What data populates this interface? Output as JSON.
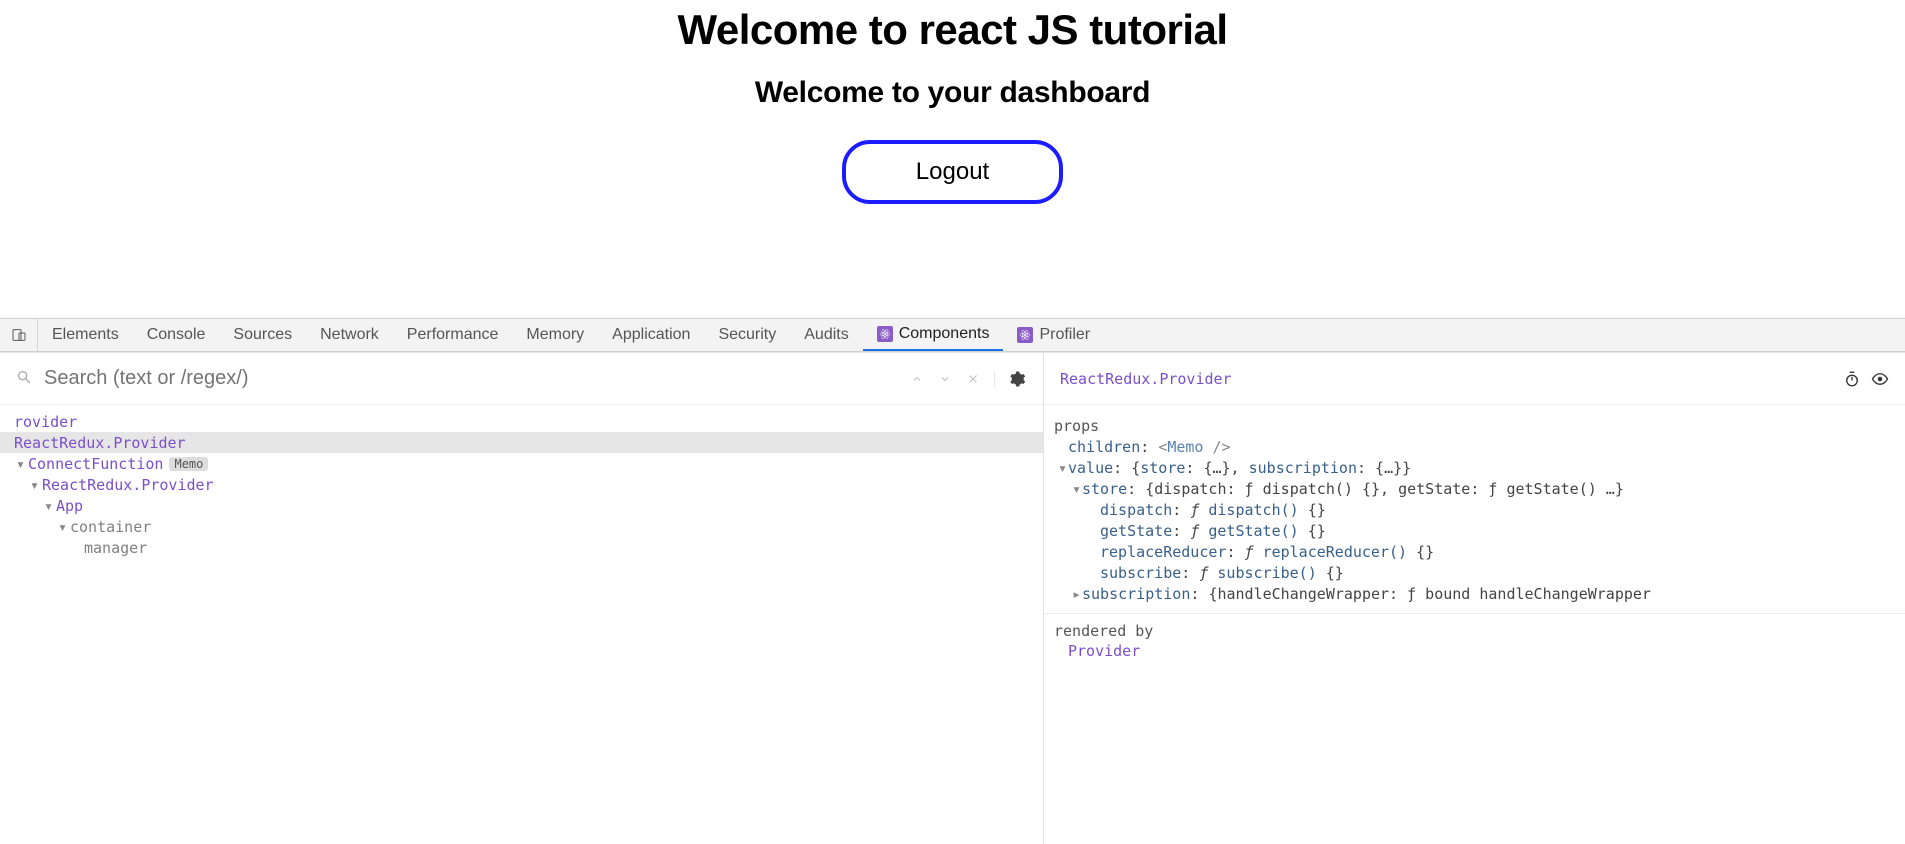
{
  "page": {
    "heading": "Welcome to react JS tutorial",
    "subheading": "Welcome to your dashboard",
    "logout_label": "Logout"
  },
  "devtools_tabs": [
    {
      "label": "Elements",
      "active": false,
      "react": false
    },
    {
      "label": "Console",
      "active": false,
      "react": false
    },
    {
      "label": "Sources",
      "active": false,
      "react": false
    },
    {
      "label": "Network",
      "active": false,
      "react": false
    },
    {
      "label": "Performance",
      "active": false,
      "react": false
    },
    {
      "label": "Memory",
      "active": false,
      "react": false
    },
    {
      "label": "Application",
      "active": false,
      "react": false
    },
    {
      "label": "Security",
      "active": false,
      "react": false
    },
    {
      "label": "Audits",
      "active": false,
      "react": false
    },
    {
      "label": "Components",
      "active": true,
      "react": true
    },
    {
      "label": "Profiler",
      "active": false,
      "react": true
    }
  ],
  "tree": {
    "search_placeholder": "Search (text or /regex/)",
    "nodes": [
      {
        "indent": 0,
        "caret": "",
        "label": "rovider",
        "selected": false,
        "badge": null,
        "dom": false
      },
      {
        "indent": 0,
        "caret": "",
        "label": "ReactRedux.Provider",
        "selected": true,
        "badge": null,
        "dom": false
      },
      {
        "indent": 1,
        "caret": "▾",
        "label": "ConnectFunction",
        "selected": false,
        "badge": "Memo",
        "dom": false
      },
      {
        "indent": 2,
        "caret": "▾",
        "label": "ReactRedux.Provider",
        "selected": false,
        "badge": null,
        "dom": false
      },
      {
        "indent": 3,
        "caret": "▾",
        "label": "App",
        "selected": false,
        "badge": null,
        "dom": false
      },
      {
        "indent": 4,
        "caret": "▾",
        "label": "container",
        "selected": false,
        "badge": null,
        "dom": true
      },
      {
        "indent": 5,
        "caret": "",
        "label": "manager",
        "selected": false,
        "badge": null,
        "dom": true
      }
    ]
  },
  "details": {
    "title": "ReactRedux.Provider",
    "props_label": "props",
    "children_key": "children",
    "children_val_tag": "Memo",
    "value_key": "value",
    "value_summary_keys": [
      "store",
      "subscription"
    ],
    "store_key": "store",
    "store_summary": "{dispatch: ƒ dispatch() {}, getState: ƒ getState() …}",
    "store_entries": [
      {
        "key": "dispatch",
        "fn": "dispatch"
      },
      {
        "key": "getState",
        "fn": "getState"
      },
      {
        "key": "replaceReducer",
        "fn": "replaceReducer"
      },
      {
        "key": "subscribe",
        "fn": "subscribe"
      }
    ],
    "subscription_key": "subscription",
    "subscription_summary": "{handleChangeWrapper: ƒ bound handleChangeWrapper",
    "rendered_by_label": "rendered by",
    "rendered_by_value": "Provider"
  }
}
